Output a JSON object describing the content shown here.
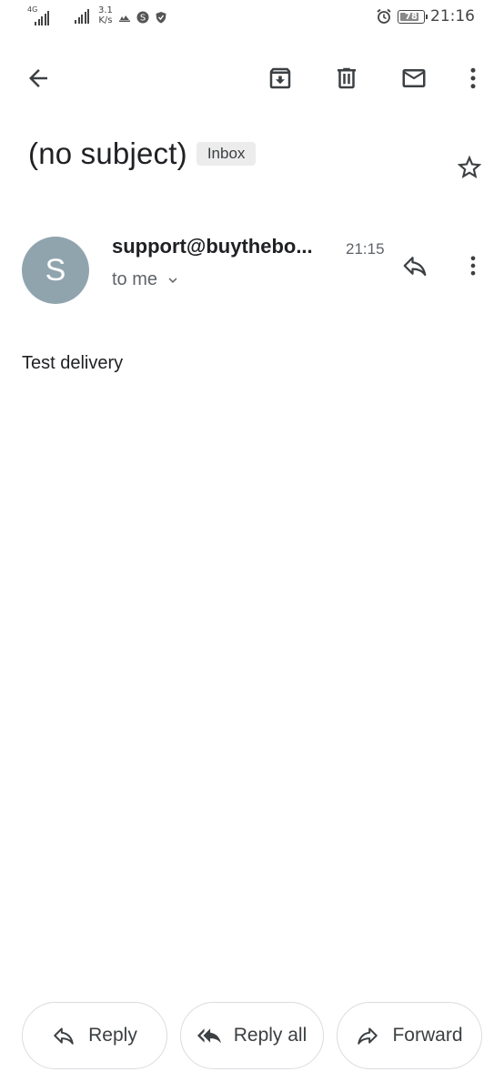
{
  "status_bar": {
    "network_type": "4G",
    "network_sub": "+",
    "speed_value": "3.1",
    "speed_unit": "K/s",
    "battery": "78",
    "time": "21:16"
  },
  "toolbar": {
    "back": "back-arrow-icon",
    "archive": "archive-icon",
    "delete": "delete-icon",
    "mark_unread": "mail-icon",
    "more": "more-vert-icon"
  },
  "email": {
    "subject": "(no subject)",
    "label": "Inbox",
    "sender_initial": "S",
    "sender": "support@buythebo...",
    "time": "21:15",
    "recipient": "to me",
    "body": "Test delivery"
  },
  "actions": {
    "reply": "Reply",
    "reply_all": "Reply all",
    "forward": "Forward"
  },
  "colors": {
    "avatar_bg": "#90a4ae",
    "icon": "#3c4043"
  }
}
